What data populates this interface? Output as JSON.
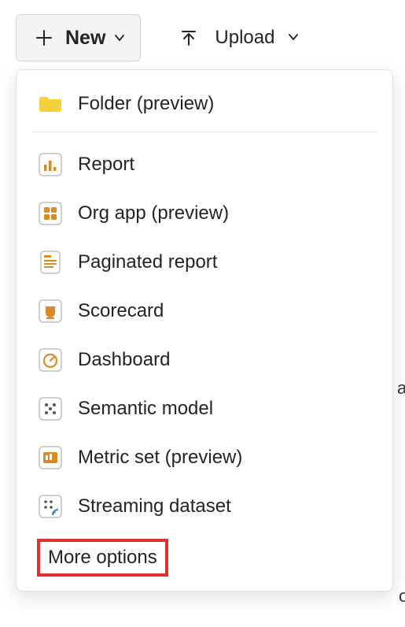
{
  "toolbar": {
    "new_label": "New",
    "upload_label": "Upload"
  },
  "menu": {
    "folder": "Folder (preview)",
    "report": "Report",
    "org_app": "Org app (preview)",
    "paginated_report": "Paginated report",
    "scorecard": "Scorecard",
    "dashboard": "Dashboard",
    "semantic_model": "Semantic model",
    "metric_set": "Metric set (preview)",
    "streaming_dataset": "Streaming dataset",
    "more_options": "More options"
  },
  "highlight": {
    "color": "#e03030"
  }
}
